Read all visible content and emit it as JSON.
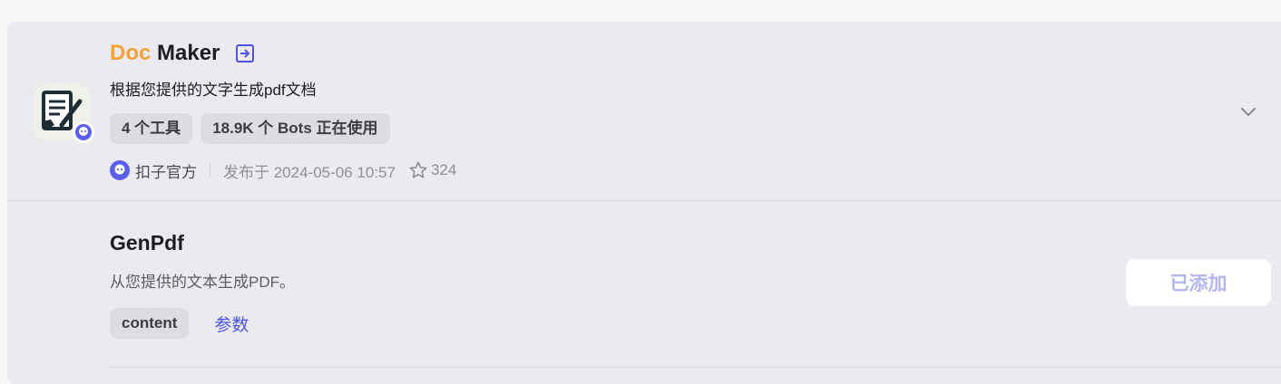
{
  "plugin": {
    "title_accent": "Doc",
    "title_rest": " Maker",
    "description": "根据您提供的文字生成pdf文档",
    "tags": [
      "4 个工具",
      "18.9K 个 Bots 正在使用"
    ],
    "author": "扣子官方",
    "published": "发布于 2024-05-06 10:57",
    "star_count": "324"
  },
  "tool": {
    "name": "GenPdf",
    "description": "从您提供的文本生成PDF。",
    "param_tag": "content",
    "params_link": "参数",
    "added_label": "已添加"
  },
  "icons": {
    "enter": "enter-icon",
    "chevron": "chevron-down-icon",
    "star": "star-icon",
    "author": "official-badge-icon"
  },
  "colors": {
    "accent": "#f5a136",
    "brand": "#4d53e8",
    "added_text": "#b3b6f2"
  }
}
